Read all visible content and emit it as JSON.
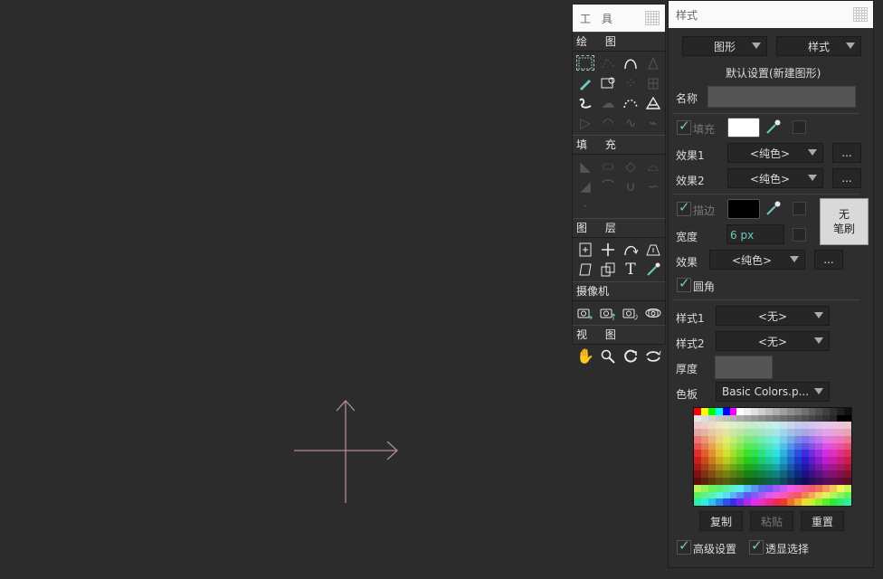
{
  "tools_panel": {
    "title": "工 具",
    "sections": [
      {
        "title": "绘 图",
        "icons": [
          "marquee-select-icon",
          "lasso-icon",
          "arc-icon",
          "bucket-outline-icon",
          "pencil-icon",
          "image-shape-icon",
          "scatter-icon",
          "grid-building-icon",
          "squiggle-icon",
          "cloud-icon",
          "dotted-arc-icon",
          "star-shape-icon",
          "play-outline-icon",
          "half-circle-icon",
          "wave-icon",
          "zigzag-icon"
        ]
      },
      {
        "title": "填 充",
        "icons": [
          "gradient-corner-icon",
          "oval-icon",
          "diamond-icon",
          "ribbon-icon",
          "triangle-fill-icon",
          "dot-arc-icon",
          "cup-icon",
          "wave-fill-icon",
          "small-dot-icon"
        ]
      },
      {
        "title": "图 层",
        "icons": [
          "add-layer-icon",
          "plus-icon",
          "rotate-arrow-icon",
          "delete-layer-icon",
          "skew-layer-icon",
          "copy-layer-icon",
          "text-T-icon",
          "eyedropper-icon"
        ]
      },
      {
        "title": "摄像机",
        "icons": [
          "camera-add-icon",
          "camera-up-icon",
          "camera-rotate-icon",
          "camera-reset-icon"
        ]
      },
      {
        "title": "视 图",
        "icons": [
          "hand-icon",
          "magnifier-icon",
          "refresh-icon",
          "sync-icon"
        ]
      }
    ]
  },
  "styles_panel": {
    "title": "样式",
    "dropdown_shape": "图形",
    "dropdown_style": "样式",
    "default_setting": "默认设置(新建图形)",
    "name_label": "名称",
    "name_value": "",
    "fill_label": "填充",
    "effect1_label": "效果1",
    "effect1_value": "<纯色>",
    "effect2_label": "效果2",
    "effect2_value": "<纯色>",
    "more_label": "...",
    "stroke_label": "描边",
    "no_brush_line1": "无",
    "no_brush_line2": "笔刷",
    "width_label": "宽度",
    "width_value": "6 px",
    "effect_label": "效果",
    "effect_value": "<纯色>",
    "round_label": "圆角",
    "style1_label": "样式1",
    "style1_value": "<无>",
    "style2_label": "样式2",
    "style2_value": "<无>",
    "thickness_label": "厚度",
    "palette_label": "色板",
    "palette_value": "Basic Colors.p...",
    "copy_label": "复制",
    "paste_label": "粘贴",
    "reset_label": "重置",
    "advanced_label": "高级设置",
    "transparent_select_label": "透显选择",
    "colors": {
      "fill": "#ffffff",
      "stroke": "#000000",
      "accent": "#6ec9c0",
      "crosshair": "#b48c90"
    }
  }
}
